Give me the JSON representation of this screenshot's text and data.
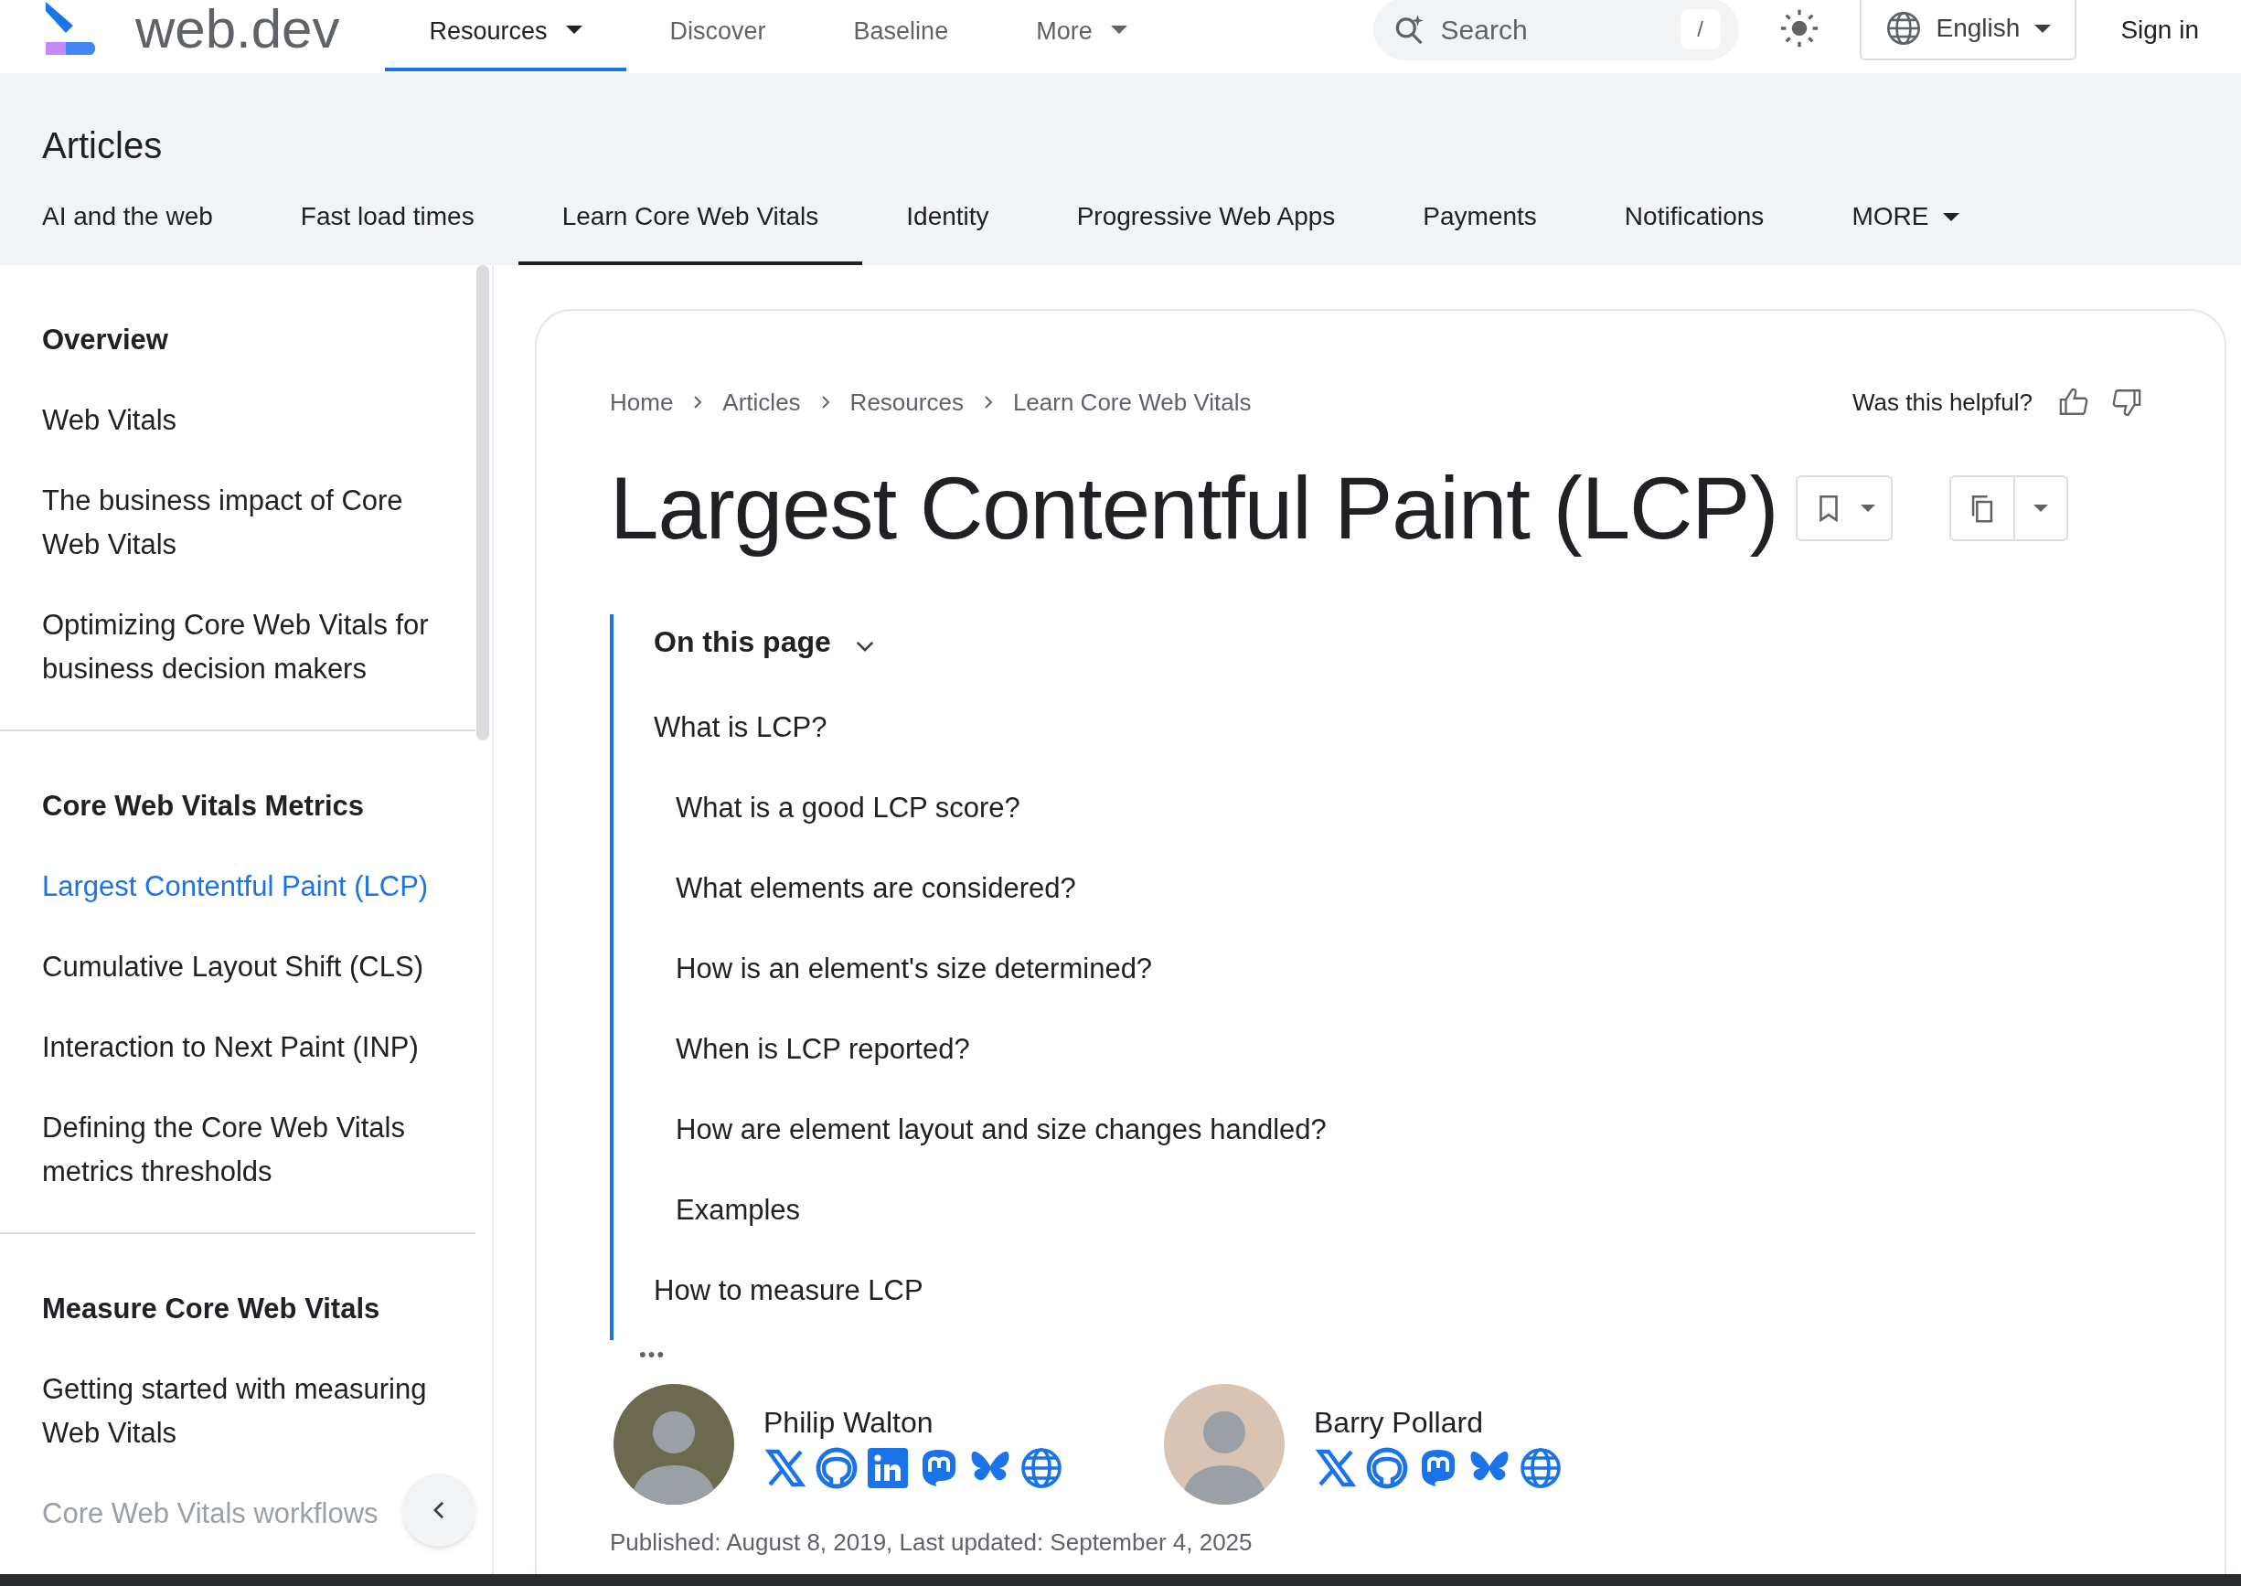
{
  "header": {
    "logo_text": "web.dev",
    "nav": [
      {
        "label": "Resources",
        "selected": true,
        "caret": true
      },
      {
        "label": "Discover",
        "selected": false,
        "caret": false
      },
      {
        "label": "Baseline",
        "selected": false,
        "caret": false
      },
      {
        "label": "More",
        "selected": false,
        "caret": true
      }
    ],
    "search": {
      "placeholder": "Search",
      "shortcut": "/"
    },
    "language": "English",
    "sign_in": "Sign in"
  },
  "section": {
    "title": "Articles",
    "tabs": [
      {
        "label": "AI and the web",
        "selected": false
      },
      {
        "label": "Fast load times",
        "selected": false
      },
      {
        "label": "Learn Core Web Vitals",
        "selected": true
      },
      {
        "label": "Identity",
        "selected": false
      },
      {
        "label": "Progressive Web Apps",
        "selected": false
      },
      {
        "label": "Payments",
        "selected": false
      },
      {
        "label": "Notifications",
        "selected": false
      }
    ],
    "more": "MORE"
  },
  "sidebar": {
    "groups": [
      {
        "heading": "Overview",
        "items": [
          {
            "label": "Web Vitals",
            "selected": false
          },
          {
            "label": "The business impact of Core Web Vitals",
            "selected": false
          },
          {
            "label": "Optimizing Core Web Vitals for business decision makers",
            "selected": false
          }
        ]
      },
      {
        "heading": "Core Web Vitals Metrics",
        "items": [
          {
            "label": "Largest Contentful Paint (LCP)",
            "selected": true
          },
          {
            "label": "Cumulative Layout Shift (CLS)",
            "selected": false
          },
          {
            "label": "Interaction to Next Paint (INP)",
            "selected": false
          },
          {
            "label": "Defining the Core Web Vitals metrics thresholds",
            "selected": false
          }
        ]
      },
      {
        "heading": "Measure Core Web Vitals",
        "items": [
          {
            "label": "Getting started with measuring Web Vitals",
            "selected": false
          },
          {
            "label": "Core Web Vitals workflows",
            "selected": false
          }
        ]
      }
    ]
  },
  "breadcrumbs": [
    "Home",
    "Articles",
    "Resources",
    "Learn Core Web Vitals"
  ],
  "helpful": "Was this helpful?",
  "title": "Largest Contentful Paint (LCP)",
  "toc": {
    "heading": "On this page",
    "items": [
      {
        "label": "What is LCP?",
        "children": [
          {
            "label": "What is a good LCP score?"
          },
          {
            "label": "What elements are considered?"
          },
          {
            "label": "How is an element's size determined?"
          },
          {
            "label": "When is LCP reported?"
          },
          {
            "label": "How are element layout and size changes handled?"
          },
          {
            "label": "Examples"
          }
        ]
      },
      {
        "label": "How to measure LCP"
      }
    ],
    "more": "•••"
  },
  "authors": [
    {
      "name": "Philip Walton",
      "links": [
        {
          "kind": "x"
        },
        {
          "kind": "github"
        },
        {
          "kind": "linkedin"
        },
        {
          "kind": "mastodon"
        },
        {
          "kind": "bluesky"
        },
        {
          "kind": "website"
        }
      ]
    },
    {
      "name": "Barry Pollard",
      "links": [
        {
          "kind": "x"
        },
        {
          "kind": "github"
        },
        {
          "kind": "mastodon"
        },
        {
          "kind": "bluesky"
        },
        {
          "kind": "website"
        }
      ]
    }
  ],
  "published": "Published: August 8, 2019, Last updated: September 4, 2025"
}
